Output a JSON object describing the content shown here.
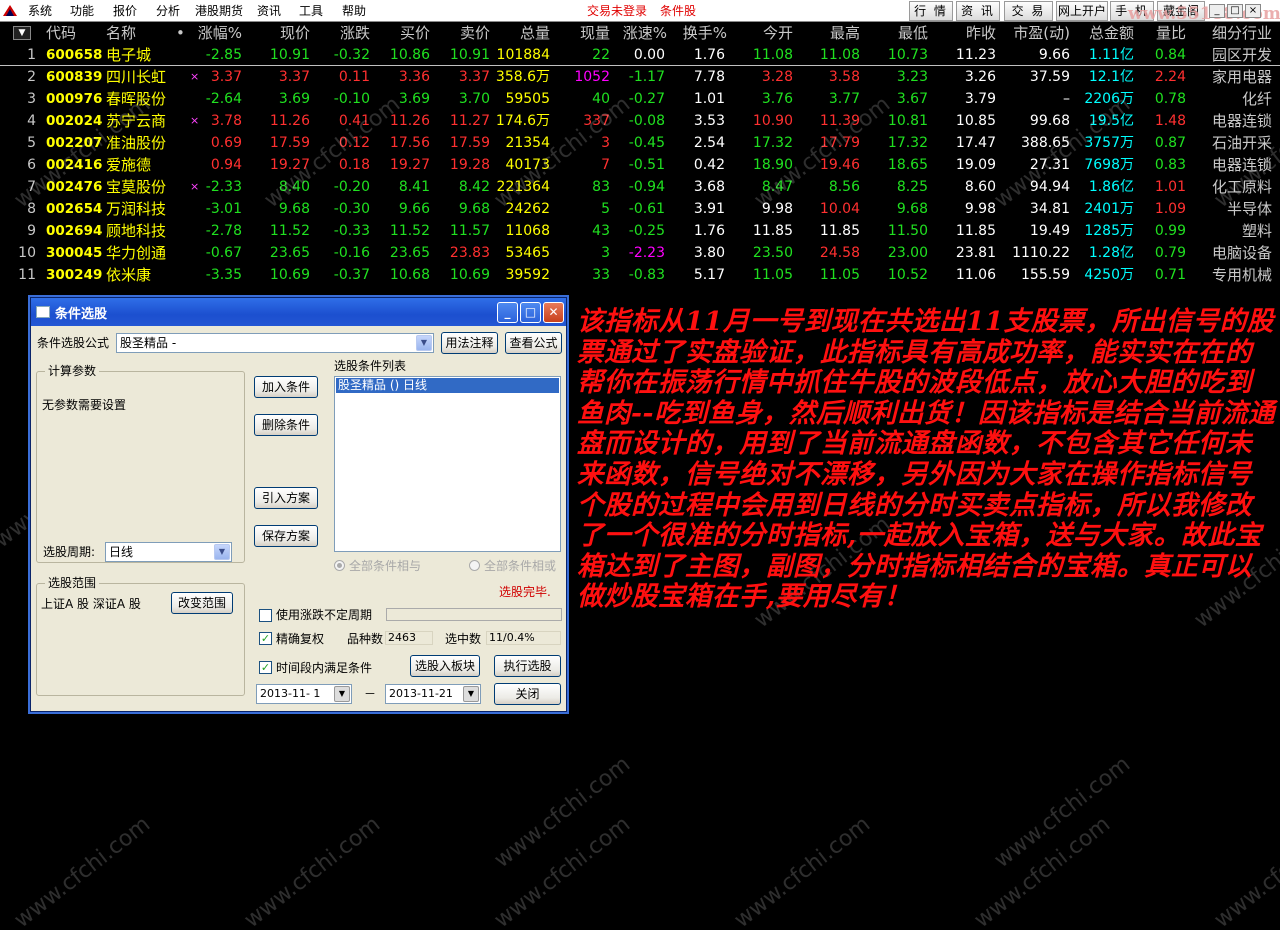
{
  "menu": [
    "系统",
    "功能",
    "报价",
    "分析",
    "港股期货",
    "资讯",
    "工具",
    "帮助"
  ],
  "status": {
    "login": "交易未登录",
    "mode": "条件股"
  },
  "top_buttons": [
    "行 情",
    "资 讯",
    "交 易",
    "网上开户",
    "手 机",
    "藏金阁"
  ],
  "watermark_logo": "www.55188.com",
  "window_controls": [
    "_",
    "□",
    "×"
  ],
  "table": {
    "headers": [
      "代码",
      "名称",
      "•",
      "涨幅%",
      "现价",
      "涨跌",
      "买价",
      "卖价",
      "总量",
      "现量",
      "涨速%",
      "换手%",
      "今开",
      "最高",
      "最低",
      "昨收",
      "市盈(动)",
      "总金额",
      "量比",
      "细分行业"
    ],
    "rows": [
      {
        "idx": "1",
        "code": "600658",
        "name": "电子城",
        "mark": "",
        "chg_pct": "-2.85",
        "price": "10.91",
        "chg": "-0.32",
        "bid": "10.86",
        "ask": "10.91",
        "vol": "101884",
        "vol_unit": "",
        "cur": "22",
        "spd": "0.00",
        "turn": "1.76",
        "open": "11.08",
        "high": "11.08",
        "low": "10.73",
        "prev": "11.23",
        "pe": "9.66",
        "amt": "1.11",
        "amt_unit": "亿",
        "vr": "0.84",
        "ind": "园区开发"
      },
      {
        "idx": "2",
        "code": "600839",
        "name": "四川长虹",
        "mark": "×",
        "chg_pct": "3.37",
        "price": "3.37",
        "chg": "0.11",
        "bid": "3.36",
        "ask": "3.37",
        "vol": "358.6",
        "vol_unit": "万",
        "cur": "1052",
        "spd": "-1.17",
        "turn": "7.78",
        "open": "3.28",
        "high": "3.58",
        "low": "3.23",
        "prev": "3.26",
        "pe": "37.59",
        "amt": "12.1",
        "amt_unit": "亿",
        "vr": "2.24",
        "ind": "家用电器"
      },
      {
        "idx": "3",
        "code": "000976",
        "name": "春晖股份",
        "mark": "",
        "chg_pct": "-2.64",
        "price": "3.69",
        "chg": "-0.10",
        "bid": "3.69",
        "ask": "3.70",
        "vol": "59505",
        "vol_unit": "",
        "cur": "40",
        "spd": "-0.27",
        "turn": "1.01",
        "open": "3.76",
        "high": "3.77",
        "low": "3.67",
        "prev": "3.79",
        "pe": "–",
        "amt": "2206",
        "amt_unit": "万",
        "vr": "0.78",
        "ind": "化纤"
      },
      {
        "idx": "4",
        "code": "002024",
        "name": "苏宁云商",
        "mark": "×",
        "chg_pct": "3.78",
        "price": "11.26",
        "chg": "0.41",
        "bid": "11.26",
        "ask": "11.27",
        "vol": "174.6",
        "vol_unit": "万",
        "cur": "337",
        "spd": "-0.08",
        "turn": "3.53",
        "open": "10.90",
        "high": "11.39",
        "low": "10.81",
        "prev": "10.85",
        "pe": "99.68",
        "amt": "19.5",
        "amt_unit": "亿",
        "vr": "1.48",
        "ind": "电器连锁"
      },
      {
        "idx": "5",
        "code": "002207",
        "name": "准油股份",
        "mark": "",
        "chg_pct": "0.69",
        "price": "17.59",
        "chg": "0.12",
        "bid": "17.56",
        "ask": "17.59",
        "vol": "21354",
        "vol_unit": "",
        "cur": "3",
        "spd": "-0.45",
        "turn": "2.54",
        "open": "17.32",
        "high": "17.79",
        "low": "17.32",
        "prev": "17.47",
        "pe": "388.65",
        "amt": "3757",
        "amt_unit": "万",
        "vr": "0.87",
        "ind": "石油开采"
      },
      {
        "idx": "6",
        "code": "002416",
        "name": "爱施德",
        "mark": "",
        "chg_pct": "0.94",
        "price": "19.27",
        "chg": "0.18",
        "bid": "19.27",
        "ask": "19.28",
        "vol": "40173",
        "vol_unit": "",
        "cur": "7",
        "spd": "-0.51",
        "turn": "0.42",
        "open": "18.90",
        "high": "19.46",
        "low": "18.65",
        "prev": "19.09",
        "pe": "27.31",
        "amt": "7698",
        "amt_unit": "万",
        "vr": "0.83",
        "ind": "电器连锁"
      },
      {
        "idx": "7",
        "code": "002476",
        "name": "宝莫股份",
        "mark": "×",
        "chg_pct": "-2.33",
        "price": "8.40",
        "chg": "-0.20",
        "bid": "8.41",
        "ask": "8.42",
        "vol": "221364",
        "vol_unit": "",
        "cur": "83",
        "spd": "-0.94",
        "turn": "3.68",
        "open": "8.47",
        "high": "8.56",
        "low": "8.25",
        "prev": "8.60",
        "pe": "94.94",
        "amt": "1.86",
        "amt_unit": "亿",
        "vr": "1.01",
        "ind": "化工原料"
      },
      {
        "idx": "8",
        "code": "002654",
        "name": "万润科技",
        "mark": "",
        "chg_pct": "-3.01",
        "price": "9.68",
        "chg": "-0.30",
        "bid": "9.66",
        "ask": "9.68",
        "vol": "24262",
        "vol_unit": "",
        "cur": "5",
        "spd": "-0.61",
        "turn": "3.91",
        "open": "9.98",
        "high": "10.04",
        "low": "9.68",
        "prev": "9.98",
        "pe": "34.81",
        "amt": "2401",
        "amt_unit": "万",
        "vr": "1.09",
        "ind": "半导体"
      },
      {
        "idx": "9",
        "code": "002694",
        "name": "顾地科技",
        "mark": "",
        "chg_pct": "-2.78",
        "price": "11.52",
        "chg": "-0.33",
        "bid": "11.52",
        "ask": "11.57",
        "vol": "11068",
        "vol_unit": "",
        "cur": "43",
        "spd": "-0.25",
        "turn": "1.76",
        "open": "11.85",
        "high": "11.85",
        "low": "11.50",
        "prev": "11.85",
        "pe": "19.49",
        "amt": "1285",
        "amt_unit": "万",
        "vr": "0.99",
        "ind": "塑料"
      },
      {
        "idx": "10",
        "code": "300045",
        "name": "华力创通",
        "mark": "",
        "chg_pct": "-0.67",
        "price": "23.65",
        "chg": "-0.16",
        "bid": "23.65",
        "ask": "23.83",
        "vol": "53465",
        "vol_unit": "",
        "cur": "3",
        "spd": "-2.23",
        "turn": "3.80",
        "open": "23.50",
        "high": "24.58",
        "low": "23.00",
        "prev": "23.81",
        "pe": "1110.22",
        "amt": "1.28",
        "amt_unit": "亿",
        "vr": "0.79",
        "ind": "电脑设备"
      },
      {
        "idx": "11",
        "code": "300249",
        "name": "依米康",
        "mark": "",
        "chg_pct": "-3.35",
        "price": "10.69",
        "chg": "-0.37",
        "bid": "10.68",
        "ask": "10.69",
        "vol": "39592",
        "vol_unit": "",
        "cur": "33",
        "spd": "-0.83",
        "turn": "5.17",
        "open": "11.05",
        "high": "11.05",
        "low": "10.52",
        "prev": "11.06",
        "pe": "155.59",
        "amt": "4250",
        "amt_unit": "万",
        "vr": "0.71",
        "ind": "专用机械"
      }
    ]
  },
  "dialog": {
    "title": "条件选股",
    "formula_label": "条件选股公式",
    "formula_value": "股圣精品 -",
    "usage_btn": "用法注释",
    "view_btn": "查看公式",
    "calc_group": "计算参数",
    "no_params": "无参数需要设置",
    "add_btn": "加入条件",
    "del_btn": "删除条件",
    "import_btn": "引入方案",
    "save_btn": "保存方案",
    "list_label": "选股条件列表",
    "list_item": "股圣精品  () 日线",
    "radio_and": "全部条件相与",
    "radio_or": "全部条件相或",
    "period_label": "选股周期:",
    "period_value": "日线",
    "done_text": "选股完毕.",
    "range_group": "选股范围",
    "range_value": "上证A 股  深证A 股",
    "range_btn": "改变范围",
    "chk_uncertain": "使用涨跌不定周期",
    "chk_adjust": "精确复权",
    "total_label": "品种数",
    "total_value": "2463",
    "selected_label": "选中数",
    "selected_value": "11/0.4%",
    "chk_time": "时间段内满足条件",
    "to_board_btn": "选股入板块",
    "run_btn": "执行选股",
    "date_from": "2013-11- 1",
    "date_sep": "－",
    "date_to": "2013-11-21",
    "close_btn": "关闭"
  },
  "note": "该指标从11月一号到现在共选出11支股票，所出信号的股票通过了实盘验证，此指标具有高成功率，能实实在在的帮你在振荡行情中抓住牛股的波段低点，放心大胆的吃到鱼肉--吃到鱼身，然后顺利出货！因该指标是结合当前流通盘而设计的，用到了当前流通盘函数，不包含其它任何未来函数，信号绝对不漂移，另外因为大家在操作指标信号个股的过程中会用到日线的分时买卖点指标，所以我修改了一个很准的分时指标,一起放入宝箱，送与大家。故此宝箱达到了主图，副图，分时指标相结合的宝箱。真正可以做炒股宝箱在手,要用尽有！",
  "watermark": "www.cfchi.com",
  "colors": {
    "up": "#ff3030",
    "down": "#20e020",
    "code": "#ffff00",
    "note": "#ff1010",
    "dialog_title": "#1c4fcf"
  }
}
